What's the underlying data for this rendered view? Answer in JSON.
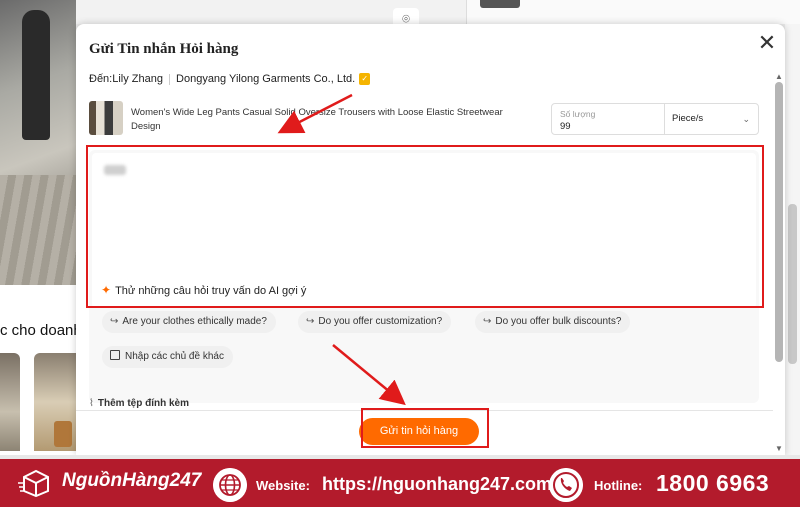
{
  "background": {
    "heading_partial": "c cho doanh"
  },
  "modal": {
    "title": "Gửi Tin nhắn Hỏi hàng",
    "close_glyph": "✕",
    "to_label": "Đến:",
    "to_name": "Lily Zhang",
    "company": "Dongyang Yilong Garments Co., Ltd.",
    "product": {
      "name": "Women's Wide Leg Pants Casual Solid Oversize Trousers with Loose Elastic Streetwear Design",
      "quantity_label": "Số lượng",
      "quantity_value": "99",
      "unit": "Piece/s"
    },
    "ai_prompt": "Thử những câu hỏi truy vấn do AI gợi ý",
    "suggestions": [
      "Are your clothes ethically made?",
      "Do you offer customization?",
      "Do you offer bulk discounts?"
    ],
    "custom_topic": "Nhập các chủ đề khác",
    "attach_label": "Thêm tệp đính kèm",
    "send_label": "Gửi tin hỏi hàng"
  },
  "banner": {
    "brand": "NguồnHàng247",
    "website_label": "Website:",
    "website_url": "https://nguonhang247.com/",
    "hotline_label": "Hotline:",
    "hotline_number": "1800 6963"
  },
  "colors": {
    "accent_orange": "#ff6a00",
    "annotation_red": "#e01b1b",
    "banner_red": "#b31b2c"
  },
  "icons": [
    "camera-icon",
    "close-icon",
    "verified-badge-icon",
    "chevron-down-icon",
    "sparkle-icon",
    "reply-arrow-icon",
    "edit-icon",
    "paperclip-icon",
    "box-logo-icon",
    "globe-icon",
    "phone-icon"
  ]
}
